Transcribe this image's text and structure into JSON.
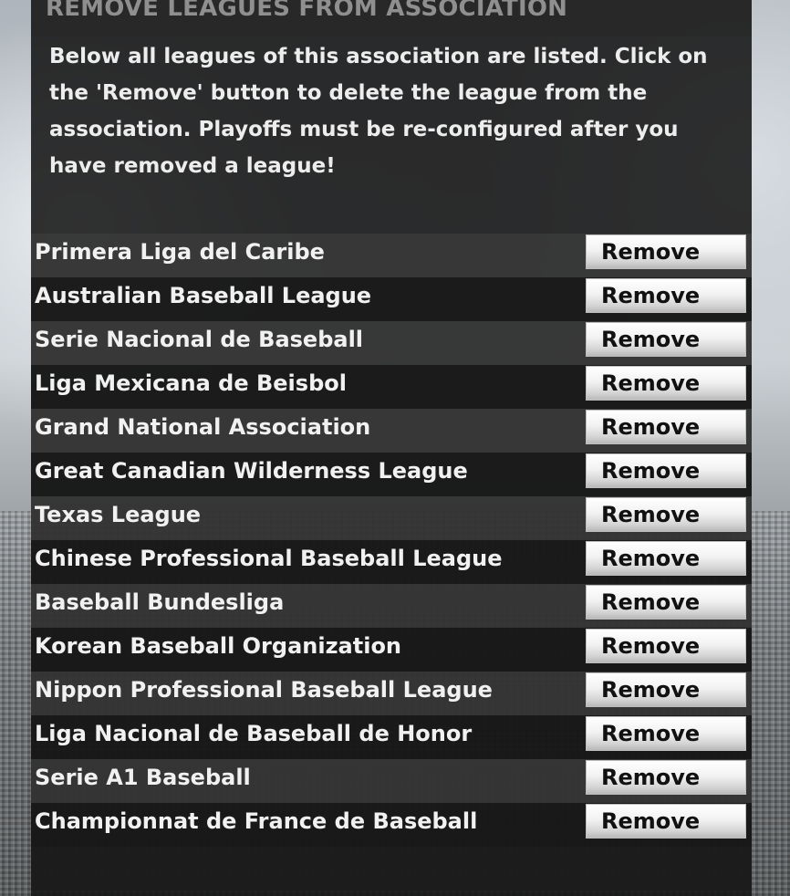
{
  "page": {
    "title": "REMOVE LEAGUES FROM ASSOCIATION",
    "description": "Below all leagues of this association are listed. Click on the 'Remove' button to delete the league from the association. Playoffs must be re-configured after you have removed a league!",
    "remove_label": "Remove"
  },
  "leagues": [
    {
      "name": "Primera Liga del Caribe",
      "action": "Remove"
    },
    {
      "name": "Australian Baseball League",
      "action": "Remove"
    },
    {
      "name": "Serie Nacional de Baseball",
      "action": "Remove"
    },
    {
      "name": "Liga Mexicana de Beisbol",
      "action": "Remove"
    },
    {
      "name": "Grand National Association",
      "action": "Remove"
    },
    {
      "name": "Great Canadian Wilderness League",
      "action": "Remove"
    },
    {
      "name": "Texas League",
      "action": "Remove"
    },
    {
      "name": "Chinese Professional Baseball League",
      "action": "Remove"
    },
    {
      "name": "Baseball Bundesliga",
      "action": "Remove"
    },
    {
      "name": "Korean Baseball Organization",
      "action": "Remove"
    },
    {
      "name": "Nippon Professional Baseball League",
      "action": "Remove"
    },
    {
      "name": "Liga Nacional de Baseball de Honor",
      "action": "Remove"
    },
    {
      "name": "Serie A1 Baseball",
      "action": "Remove"
    },
    {
      "name": "Championnat de France de Baseball",
      "action": "Remove"
    }
  ]
}
